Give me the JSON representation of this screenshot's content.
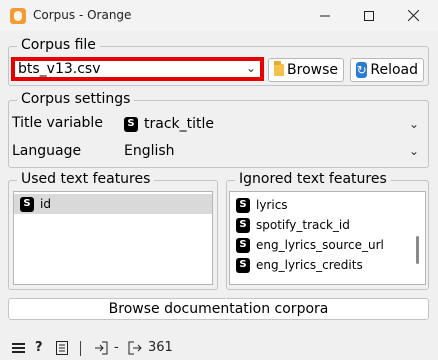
{
  "window": {
    "title": "Corpus - Orange"
  },
  "corpus_file": {
    "group_title": "Corpus file",
    "file_value": "bts_v13.csv",
    "browse_label": "Browse",
    "reload_label": "Reload"
  },
  "corpus_settings": {
    "group_title": "Corpus settings",
    "title_variable_label": "Title variable",
    "title_variable_value": "track_title",
    "language_label": "Language",
    "language_value": "English"
  },
  "used_features": {
    "group_title": "Used text features",
    "items": [
      "id"
    ]
  },
  "ignored_features": {
    "group_title": "Ignored text features",
    "items": [
      "lyrics",
      "spotify_track_id",
      "eng_lyrics_source_url",
      "eng_lyrics_credits"
    ]
  },
  "browse_docs_label": "Browse documentation corpora",
  "status": {
    "input_text": "-",
    "output_count": "361"
  },
  "colors": {
    "highlight_border": "#e60000",
    "selected_row": "#d9d9d9",
    "app_icon": "#f39c34"
  }
}
